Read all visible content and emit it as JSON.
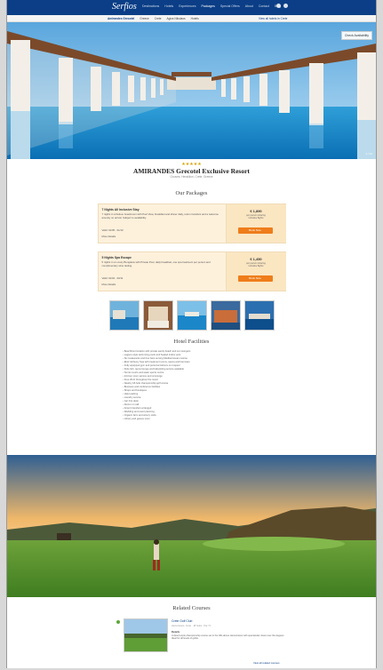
{
  "nav": {
    "logo": "Serfios",
    "items": [
      "Destinations",
      "Hotels",
      "Experiences",
      "Packages",
      "Special Offers",
      "About",
      "Contact",
      "Blog"
    ],
    "active_index": 3
  },
  "subnav": {
    "crumbs": [
      "Greece",
      "Crete",
      "Agios Nikolaos",
      "Hotels"
    ],
    "home": "Amirandes Grecotel",
    "link": "View all hotels in Crete"
  },
  "hero": {
    "badge": "Check Availability",
    "caption": "1 / 12"
  },
  "hotel": {
    "stars": "★★★★★",
    "name": "AMIRANDES Grecotel Exclusive Resort",
    "location": "Gouves, Heraklion, Crete, Greece"
  },
  "packages_heading": "Our Packages",
  "packages": [
    {
      "title": "7 Nights All Inclusive Stay",
      "desc": "7 nights in a Deluxe Guestroom with Pool View, breakfast and dinner daily, return transfers and a welcome amenity on arrival. Subject to availability.",
      "meta": "Valid: 01/05 - 31/10",
      "more": "More Details",
      "price": "€ 1,890",
      "price_note": "per person sharing\nincludes flights",
      "button": "Book Now"
    },
    {
      "title": "5 Nights Spa Escape",
      "desc": "5 nights in a Luxury Bungalow with Private Pool, daily breakfast, one spa treatment per person and complimentary wine tasting.",
      "meta": "Valid: 01/04 - 30/11",
      "more": "More Details",
      "price": "€ 1,450",
      "price_note": "per person sharing\nincludes flights",
      "button": "Book Now"
    }
  ],
  "facilities_heading": "Hotel Facilities",
  "facilities": [
    "Beachfront location with private sandy beach and sun loungers",
    "Lagoon-style swimming pools and heated indoor pool",
    "Six restaurants and four bars serving Mediterranean cuisine",
    "Elixir Alchemy Spa with treatment rooms, sauna and hammam",
    "Fully equipped gym and personal trainers on request",
    "Kids club, teens lounge and babysitting service available",
    "Tennis courts and water sports centre",
    "24-hour room service and concierge",
    "Free Wi-Fi throughout the resort",
    "Nearby 18-hole championship golf course",
    "Business and conference facilities",
    "Shops and boutiques",
    "Valet parking",
    "Laundry service",
    "Car hire desk",
    "Doctor on call",
    "Airport transfers arranged",
    "Wedding and event planning",
    "Organic farm and winery visits",
    "Library and games room"
  ],
  "related_heading": "Related Courses",
  "related": {
    "title": "Crete Golf Club",
    "sub": "Hersonissos, Crete · 18 holes · Par 71",
    "label": "Details",
    "desc": "A desert-style championship course set in the hills above Hersonissos with spectacular views over the Aegean. Ideal for all levels of golfer.",
    "more": "View all related courses"
  }
}
